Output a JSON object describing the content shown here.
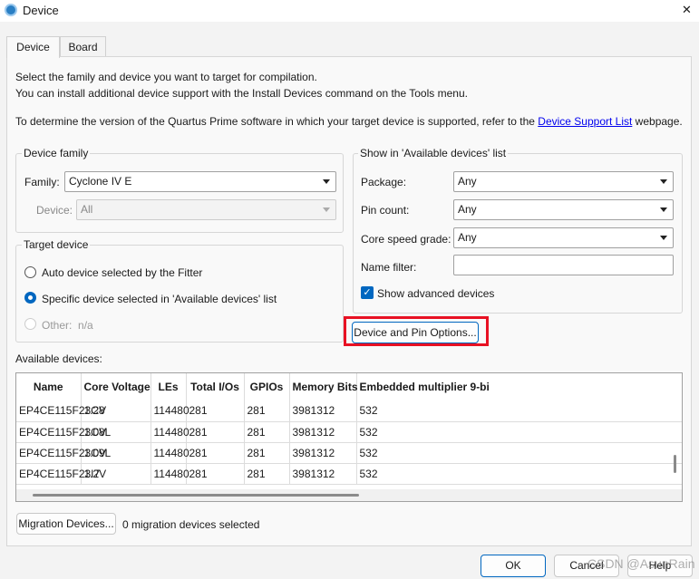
{
  "window": {
    "title": "Device",
    "close": "✕"
  },
  "tabs": [
    {
      "label": "Device"
    },
    {
      "label": "Board"
    }
  ],
  "intro": {
    "line1": "Select the family and device you want to target for compilation.",
    "line2": "You can install additional device support with the Install Devices command on the Tools menu.",
    "line3_pre": "To determine the version of the Quartus Prime software in which your target device is supported, refer to the ",
    "link": "Device Support List",
    "line3_post": " webpage."
  },
  "device_family": {
    "title": "Device family",
    "family_label": "Family:",
    "family_value": "Cyclone IV E",
    "device_label": "Device:",
    "device_value": "All"
  },
  "target_device": {
    "title": "Target device",
    "options": [
      {
        "label": "Auto device selected by the Fitter",
        "selected": false
      },
      {
        "label": "Specific device selected in 'Available devices' list",
        "selected": true
      },
      {
        "label": "Other:  n/a",
        "selected": false,
        "disabled": true
      }
    ]
  },
  "show_in": {
    "title": "Show in 'Available devices' list",
    "package_label": "Package:",
    "package_value": "Any",
    "pin_label": "Pin count:",
    "pin_value": "Any",
    "speed_label": "Core speed grade:",
    "speed_value": "Any",
    "name_filter_label": "Name filter:",
    "name_filter_value": "",
    "advanced_label": "Show advanced devices",
    "advanced_checked": true
  },
  "device_pin_button": "Device and Pin Options...",
  "available": {
    "label": "Available devices:",
    "columns": [
      "Name",
      "Core Voltage",
      "LEs",
      "Total I/Os",
      "GPIOs",
      "Memory Bits",
      "Embedded multiplier 9-bi"
    ],
    "rows": [
      [
        "EP4CE115F23C8",
        "1.2V",
        "114480",
        "281",
        "281",
        "3981312",
        "532"
      ],
      [
        "EP4CE115F23C8L",
        "1.0V",
        "114480",
        "281",
        "281",
        "3981312",
        "532"
      ],
      [
        "EP4CE115F23C9L",
        "1.0V",
        "114480",
        "281",
        "281",
        "3981312",
        "532"
      ],
      [
        "EP4CE115F23I7",
        "1.2V",
        "114480",
        "281",
        "281",
        "3981312",
        "532"
      ]
    ]
  },
  "migration": {
    "button": "Migration Devices...",
    "status": "0 migration devices selected"
  },
  "footer": {
    "ok": "OK",
    "cancel": "Cancel",
    "help": "Help"
  },
  "watermark": "CSDN @AsunRain",
  "colors": {
    "highlight": "#e81123",
    "accent": "#0067c0"
  }
}
